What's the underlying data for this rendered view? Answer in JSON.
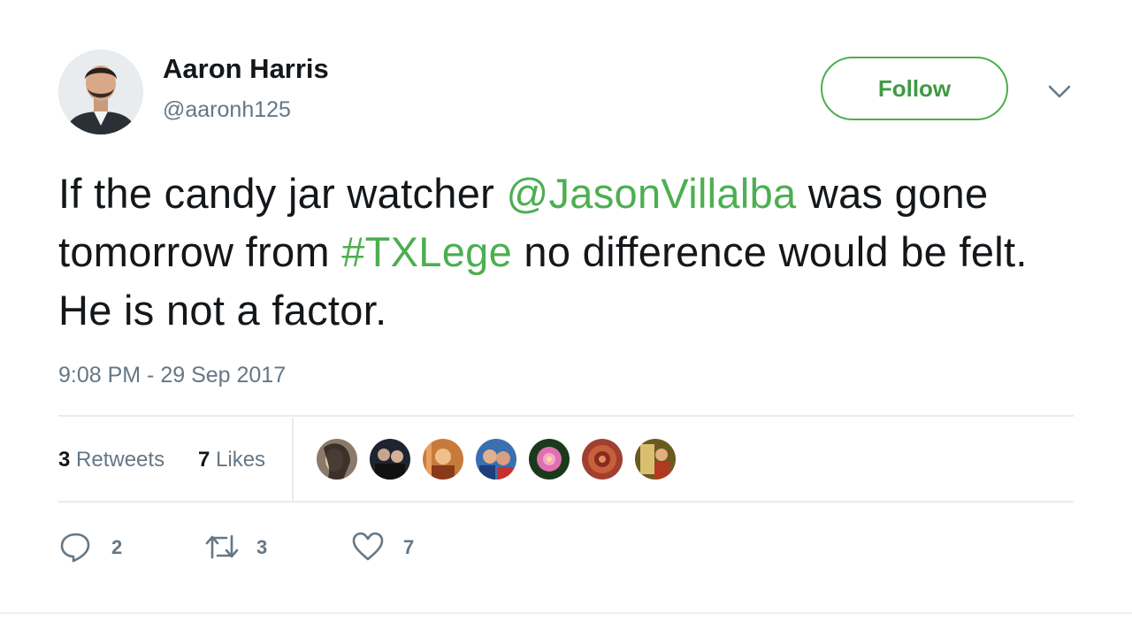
{
  "author": {
    "name": "Aaron Harris",
    "handle": "@aaronh125"
  },
  "follow_label": "Follow",
  "tweet": {
    "text_part1": "If the candy jar watcher ",
    "mention": "@JasonVillalba",
    "text_part2": " was gone tomorrow from ",
    "hashtag": "#TXLege",
    "text_part3": " no difference would be felt. He is not a factor."
  },
  "timestamp": "9:08 PM - 29 Sep 2017",
  "stats": {
    "retweets_count": "3",
    "retweets_label": "Retweets",
    "likes_count": "7",
    "likes_label": "Likes"
  },
  "actions": {
    "replies": "2",
    "retweets": "3",
    "likes": "7"
  },
  "colors": {
    "accent": "#4caf50",
    "muted": "#657786",
    "text": "#14171a"
  }
}
